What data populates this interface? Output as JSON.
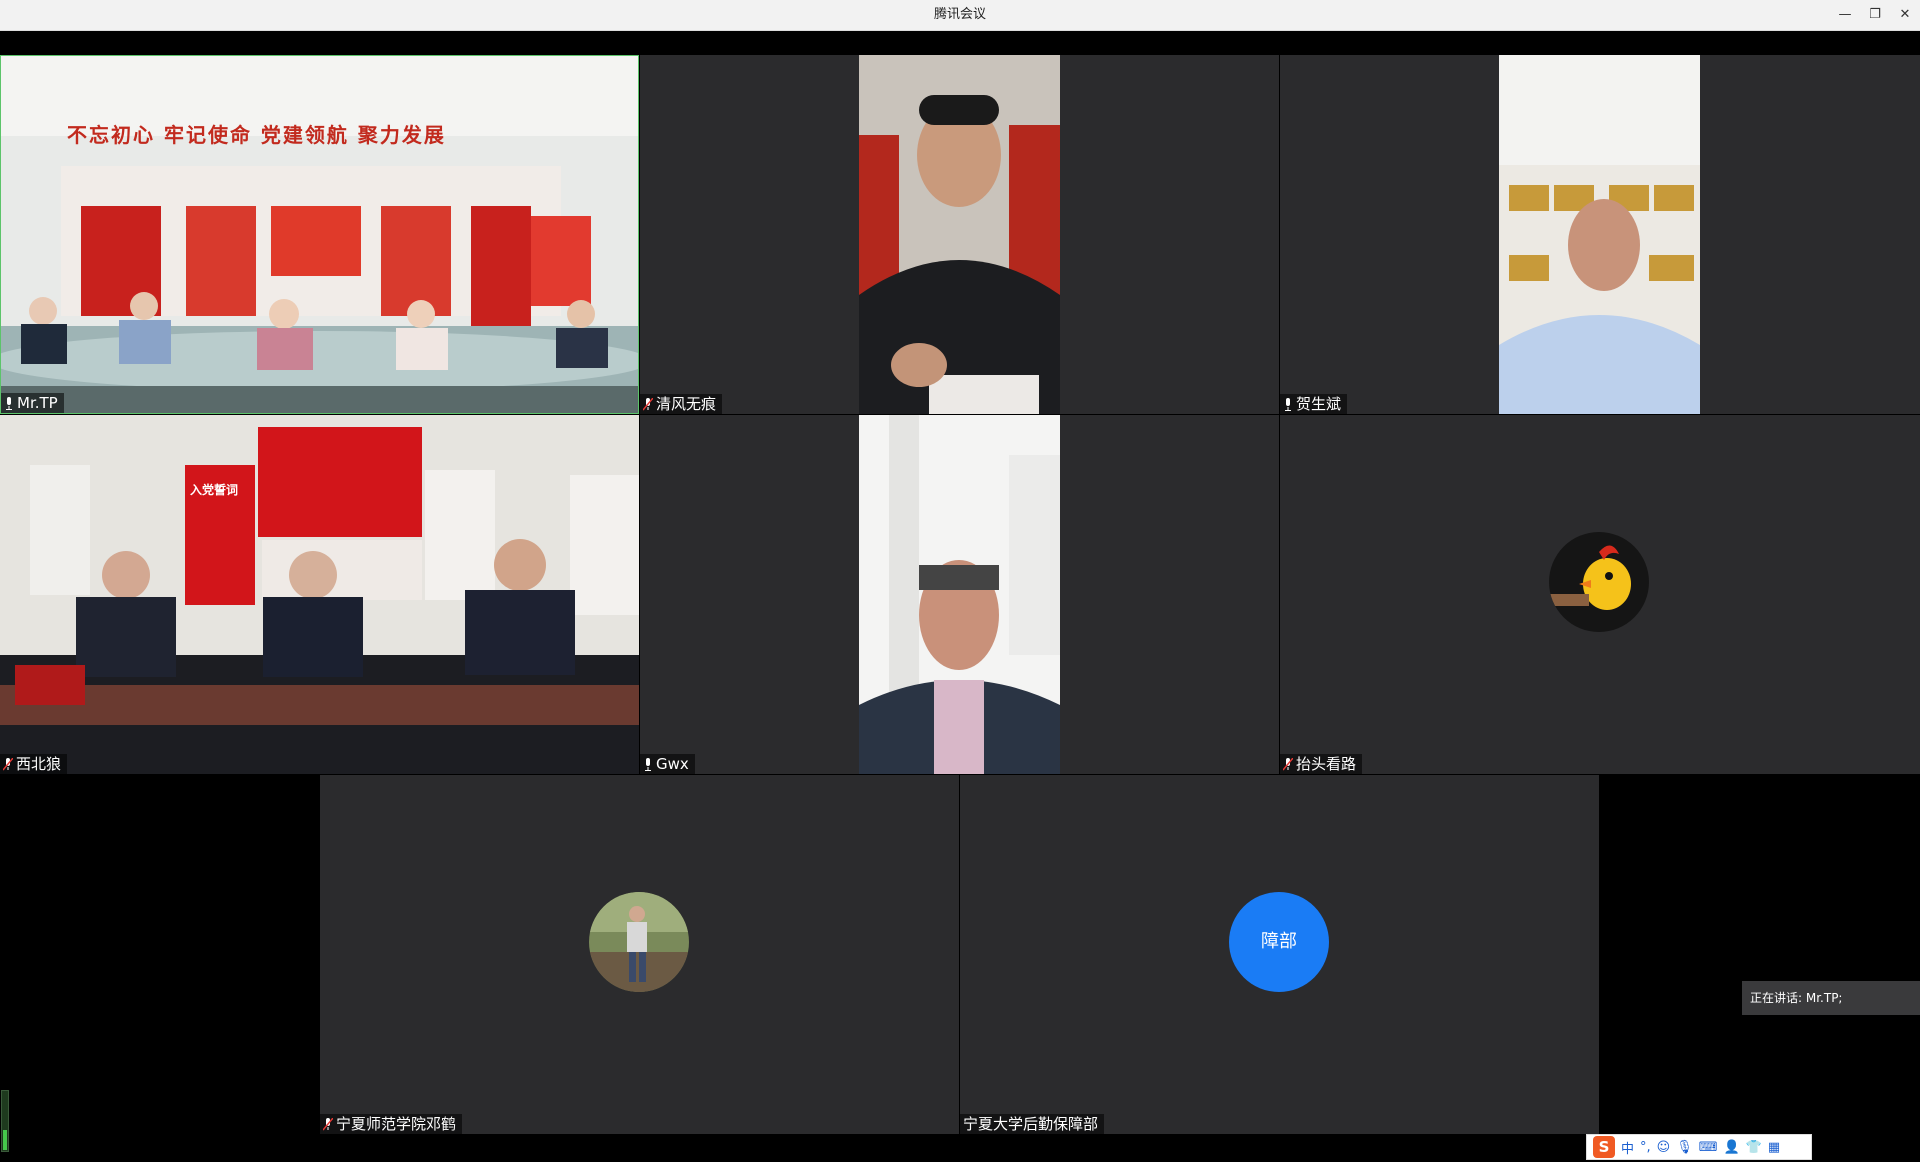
{
  "window": {
    "title": "腾讯会议",
    "minimize": "—",
    "restore": "❐",
    "close": "✕"
  },
  "participants": [
    {
      "name": "Mr.TP",
      "mic": "on"
    },
    {
      "name": "清风无痕",
      "mic": "muted"
    },
    {
      "name": "贺生斌",
      "mic": "on"
    },
    {
      "name": "西北狼",
      "mic": "muted"
    },
    {
      "name": "Gwx",
      "mic": "on"
    },
    {
      "name": "抬头看路",
      "mic": "muted"
    },
    {
      "name": "宁夏师范学院邓鹤",
      "mic": "muted"
    },
    {
      "name": "宁夏大学后勤保障部",
      "mic": "none",
      "avatar_text": "障部"
    }
  ],
  "video_scene": {
    "banner": "不忘初心 牢记使命 党建领航 聚力发展",
    "oath": "入党誓词"
  },
  "status": {
    "speaking": "正在讲话: Mr.TP;"
  },
  "ime": {
    "logo": "S",
    "mode": "中",
    "punct": "°,"
  },
  "colors": {
    "accent_blue": "#1a7cf5",
    "tile_bg": "#2b2b2d",
    "active_border": "#5cc46a"
  }
}
